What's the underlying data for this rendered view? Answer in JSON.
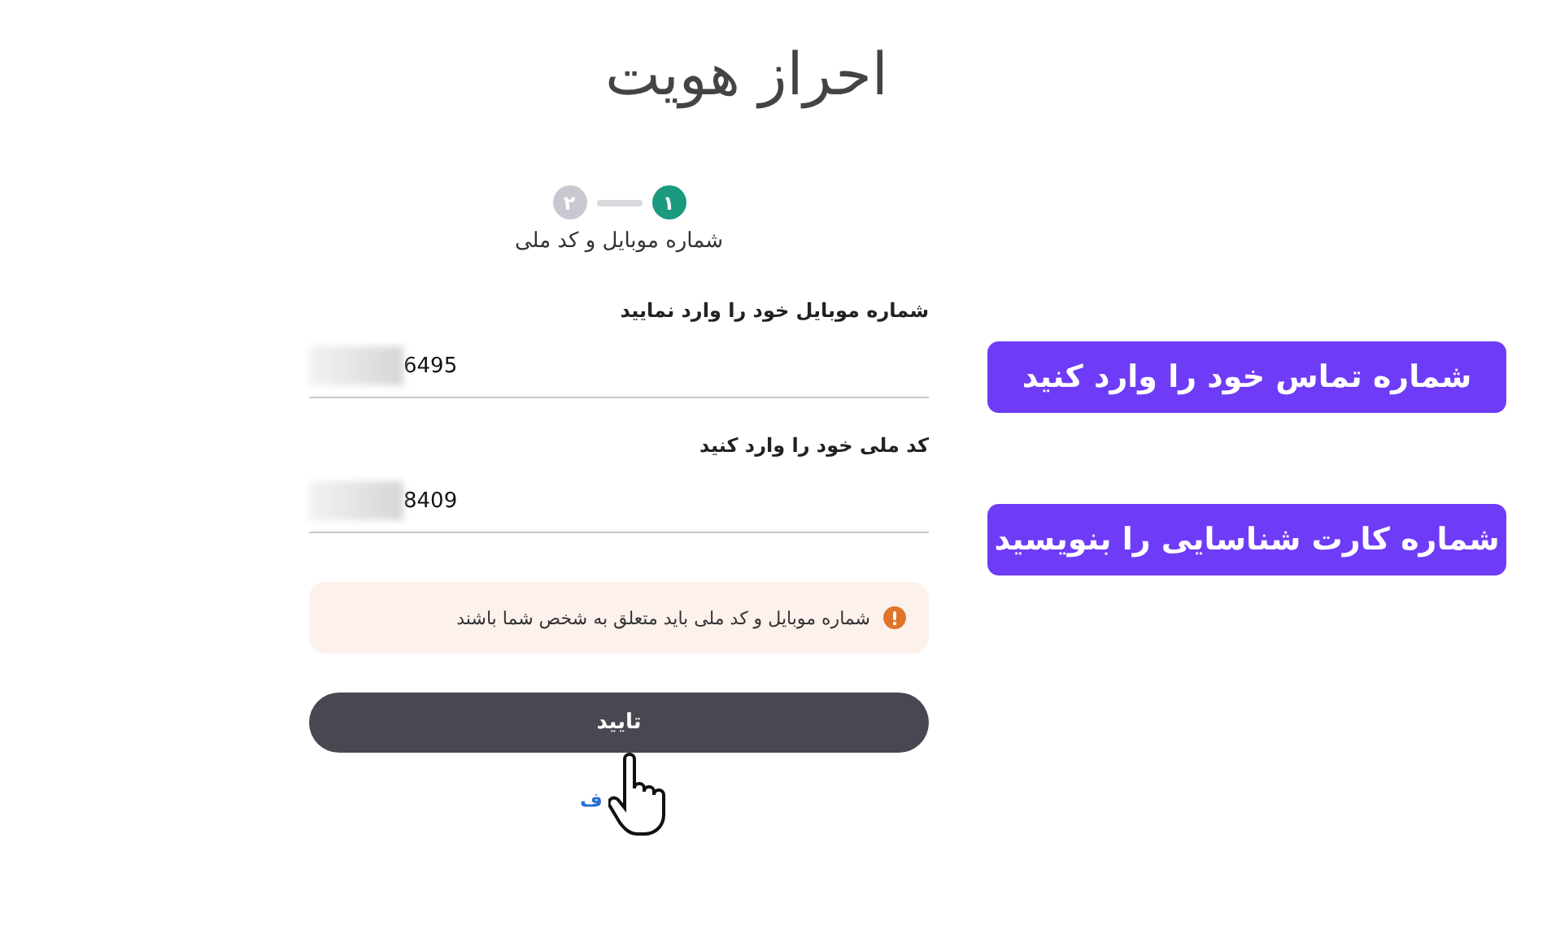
{
  "title": "احراز هویت",
  "steps": [
    {
      "number": "۱",
      "selected": true
    },
    {
      "number": "۲",
      "selected": false
    }
  ],
  "step_label": "شماره موبایل و کد ملی",
  "fields": [
    {
      "label": "شماره موبایل خود را وارد نمایید",
      "value": "6495"
    },
    {
      "label": "کد ملی خود را وارد کنید",
      "value": "8409"
    }
  ],
  "alert": {
    "text": "شماره موبایل و کد ملی باید متعلق به شخص شما باشند"
  },
  "submit": {
    "label": "تایید"
  },
  "link": "ف",
  "annotations": [
    "شماره تماس خود را وارد کنید",
    "شماره کارت شناسایی را بنویسید"
  ]
}
